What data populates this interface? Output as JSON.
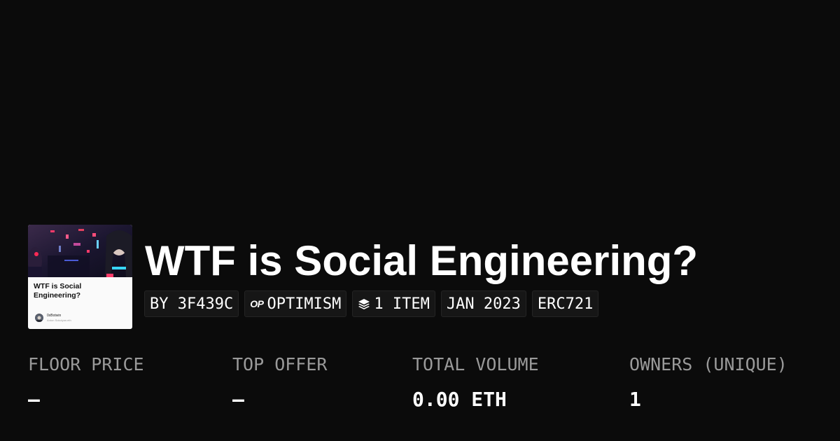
{
  "collection": {
    "name": "WTF is Social Engineering?",
    "thumbnail": {
      "title": "WTF is Social Engineering?",
      "author": "0xBotwin",
      "author_sub": "Anton Sokolyan.eth"
    },
    "badges": [
      {
        "label": "BY 3F439C",
        "icon": null
      },
      {
        "label": "OPTIMISM",
        "icon": "optimism-logo-icon",
        "icon_text": "OP"
      },
      {
        "label": "1 ITEM",
        "icon": "layers-icon"
      },
      {
        "label": "JAN 2023",
        "icon": null
      },
      {
        "label": "ERC721",
        "icon": null
      }
    ]
  },
  "stats": [
    {
      "label": "FLOOR PRICE",
      "value": "–"
    },
    {
      "label": "TOP OFFER",
      "value": "–"
    },
    {
      "label": "TOTAL VOLUME",
      "value": "0.00 ETH"
    },
    {
      "label": "OWNERS (UNIQUE)",
      "value": "1"
    }
  ],
  "colors": {
    "background": "#0b0b0b",
    "badge_background": "#161616",
    "label": "#9a9a9a",
    "text": "#ffffff"
  }
}
